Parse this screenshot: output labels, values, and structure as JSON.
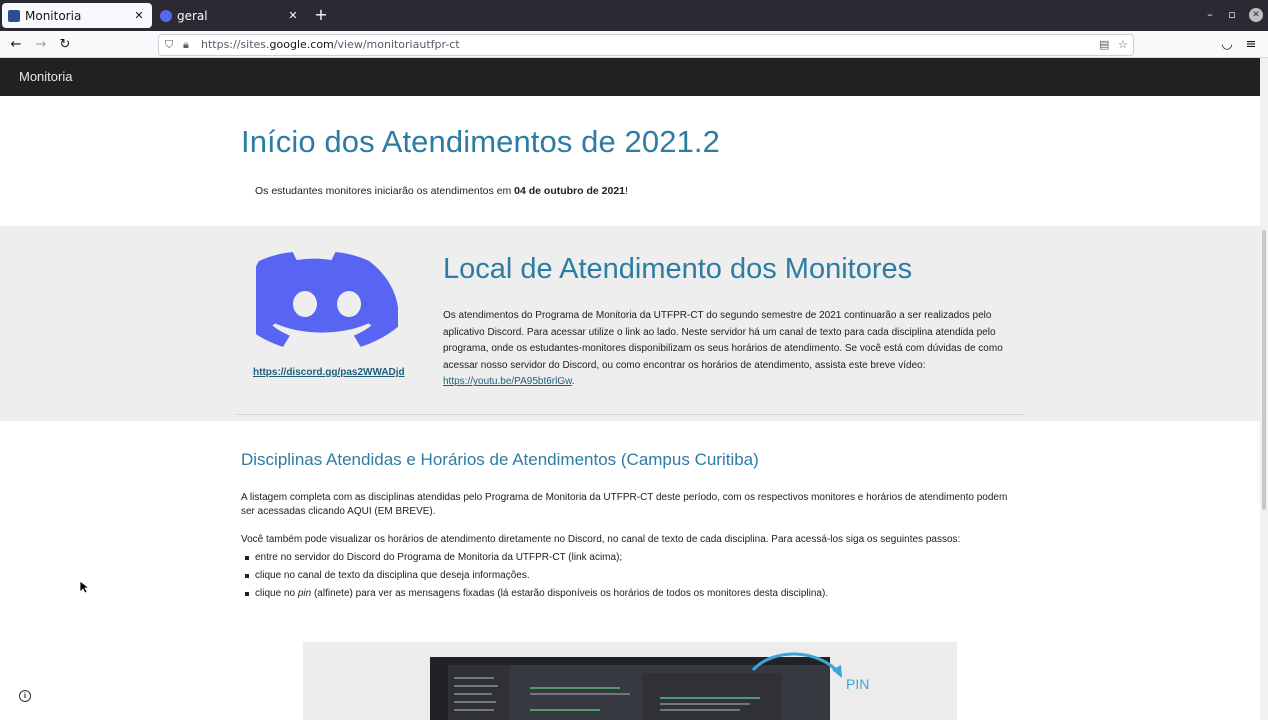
{
  "browser": {
    "tabs": [
      {
        "title": "Monitoria",
        "active": true
      },
      {
        "title": "geral",
        "active": false
      }
    ],
    "url_prefix": "https://sites.",
    "url_domain": "google.com",
    "url_path": "/view/monitoriautfpr-ct"
  },
  "site": {
    "title": "Monitoria"
  },
  "main": {
    "heading": "Início dos Atendimentos de 2021.2",
    "intro_pre": "Os estudantes monitores iniciarão os atendimentos em ",
    "intro_bold": "04 de outubro de 2021",
    "intro_post": "!"
  },
  "local": {
    "heading": "Local de Atendimento dos Monitores",
    "discord_link": "https://discord.gg/pas2WWADjd",
    "paragraph": "Os atendimentos do Programa de Monitoria da UTFPR-CT do segundo semestre de 2021 continuarão a ser realizados pelo aplicativo Discord. Para acessar utilize o link ao lado. Neste servidor há um canal de texto para cada disciplina atendida pelo programa, onde os estudantes-monitores disponibilizam os seus horários de atendimento. Se você está com dúvidas de como acessar nosso servidor do Discord, ou como encontrar os horários de atendimento, assista este breve vídeo: ",
    "video_link": "https://youtu.be/PA95bt6rlGw",
    "after_link": "."
  },
  "disciplinas": {
    "heading": "Disciplinas Atendidas e Horários de Atendimentos (Campus Curitiba)",
    "p1": "A listagem completa com as disciplinas atendidas pelo Programa de Monitoria da UTFPR-CT deste período,  com os respectivos monitores e horários de atendimento podem ser acessadas clicando AQUI (EM BREVE).",
    "p2": "Você também pode visualizar os horários de atendimento diretamente no Discord, no canal de texto de cada disciplina.  Para acessá-los siga os seguintes passos:",
    "steps": [
      "entre no servidor do Discord do Programa de Monitoria da UTFPR-CT (link acima);",
      "clique no canal de texto da disciplina que deseja informações.",
      "clique no ",
      "pin",
      " (alfinete) para ver as mensagens fixadas (lá estarão disponíveis os horários de todos os monitores desta disciplina)."
    ],
    "image_label": "PIN"
  },
  "colors": {
    "accent": "#2c7ca3",
    "header_bg": "#212121",
    "discord": "#5865f2"
  }
}
